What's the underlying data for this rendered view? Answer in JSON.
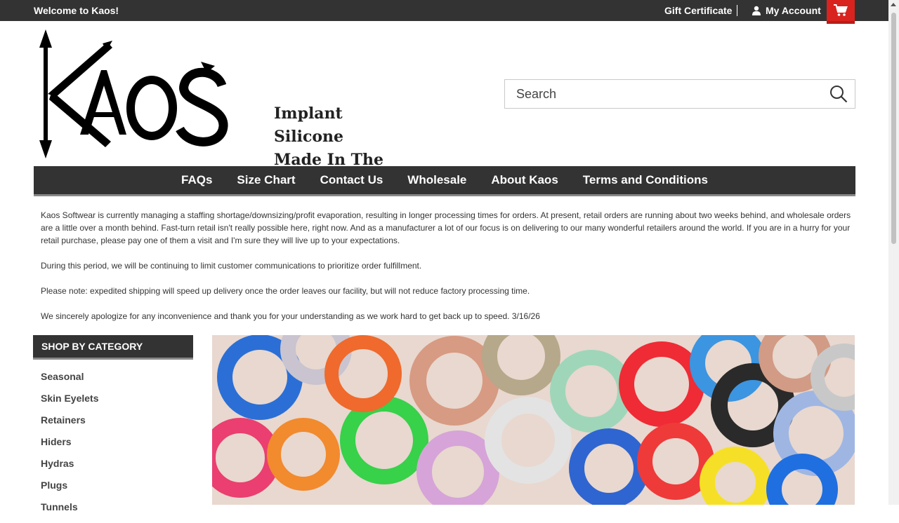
{
  "topbar": {
    "welcome": "Welcome to Kaos!",
    "gift_certificate": "Gift Certificate",
    "my_account": "My Account"
  },
  "logo": {
    "wordmark": "KAOS",
    "tagline_line1": "Implant Silicone",
    "tagline_line2": "Made In The USA"
  },
  "search": {
    "placeholder": "Search"
  },
  "nav": {
    "items": [
      {
        "label": "FAQs"
      },
      {
        "label": "Size Chart"
      },
      {
        "label": "Contact Us"
      },
      {
        "label": "Wholesale"
      },
      {
        "label": "About Kaos"
      },
      {
        "label": "Terms and Conditions"
      }
    ]
  },
  "notice": {
    "p1": "Kaos Softwear is currently managing a staffing shortage/downsizing/profit evaporation, resulting in longer processing times for orders. At present, retail orders are running about two weeks behind, and wholesale orders are a little over a month behind. Fast-turn retail isn't really possible here, right now.  And as a manufacturer a lot of our focus is on delivering to our many wonderful retailers around the world. If you are in a hurry for your retail purchase, please pay one of them a visit and I'm sure they will live up to your expectations.",
    "p2": "During this period, we will be continuing to limit customer communications to prioritize order fulfillment.",
    "p3": "Please note: expedited shipping will speed up delivery once the order leaves our facility, but will not reduce factory processing time.",
    "p4": "We sincerely apologize for any inconvenience and thank you for your understanding as we work hard to get back up to speed. 3/16/26"
  },
  "sidebar": {
    "heading": "SHOP BY CATEGORY",
    "items": [
      {
        "label": "Seasonal"
      },
      {
        "label": "Skin Eyelets"
      },
      {
        "label": "Retainers"
      },
      {
        "label": "Hiders"
      },
      {
        "label": "Hydras"
      },
      {
        "label": "Plugs"
      },
      {
        "label": "Tunnels"
      }
    ]
  },
  "colors": {
    "topbar_bg": "#333333",
    "cart_accent": "#d9231f",
    "nav_bg": "#333333"
  },
  "icons": {
    "account": "person-icon",
    "cart": "shopping-cart-icon",
    "search": "search-icon"
  }
}
